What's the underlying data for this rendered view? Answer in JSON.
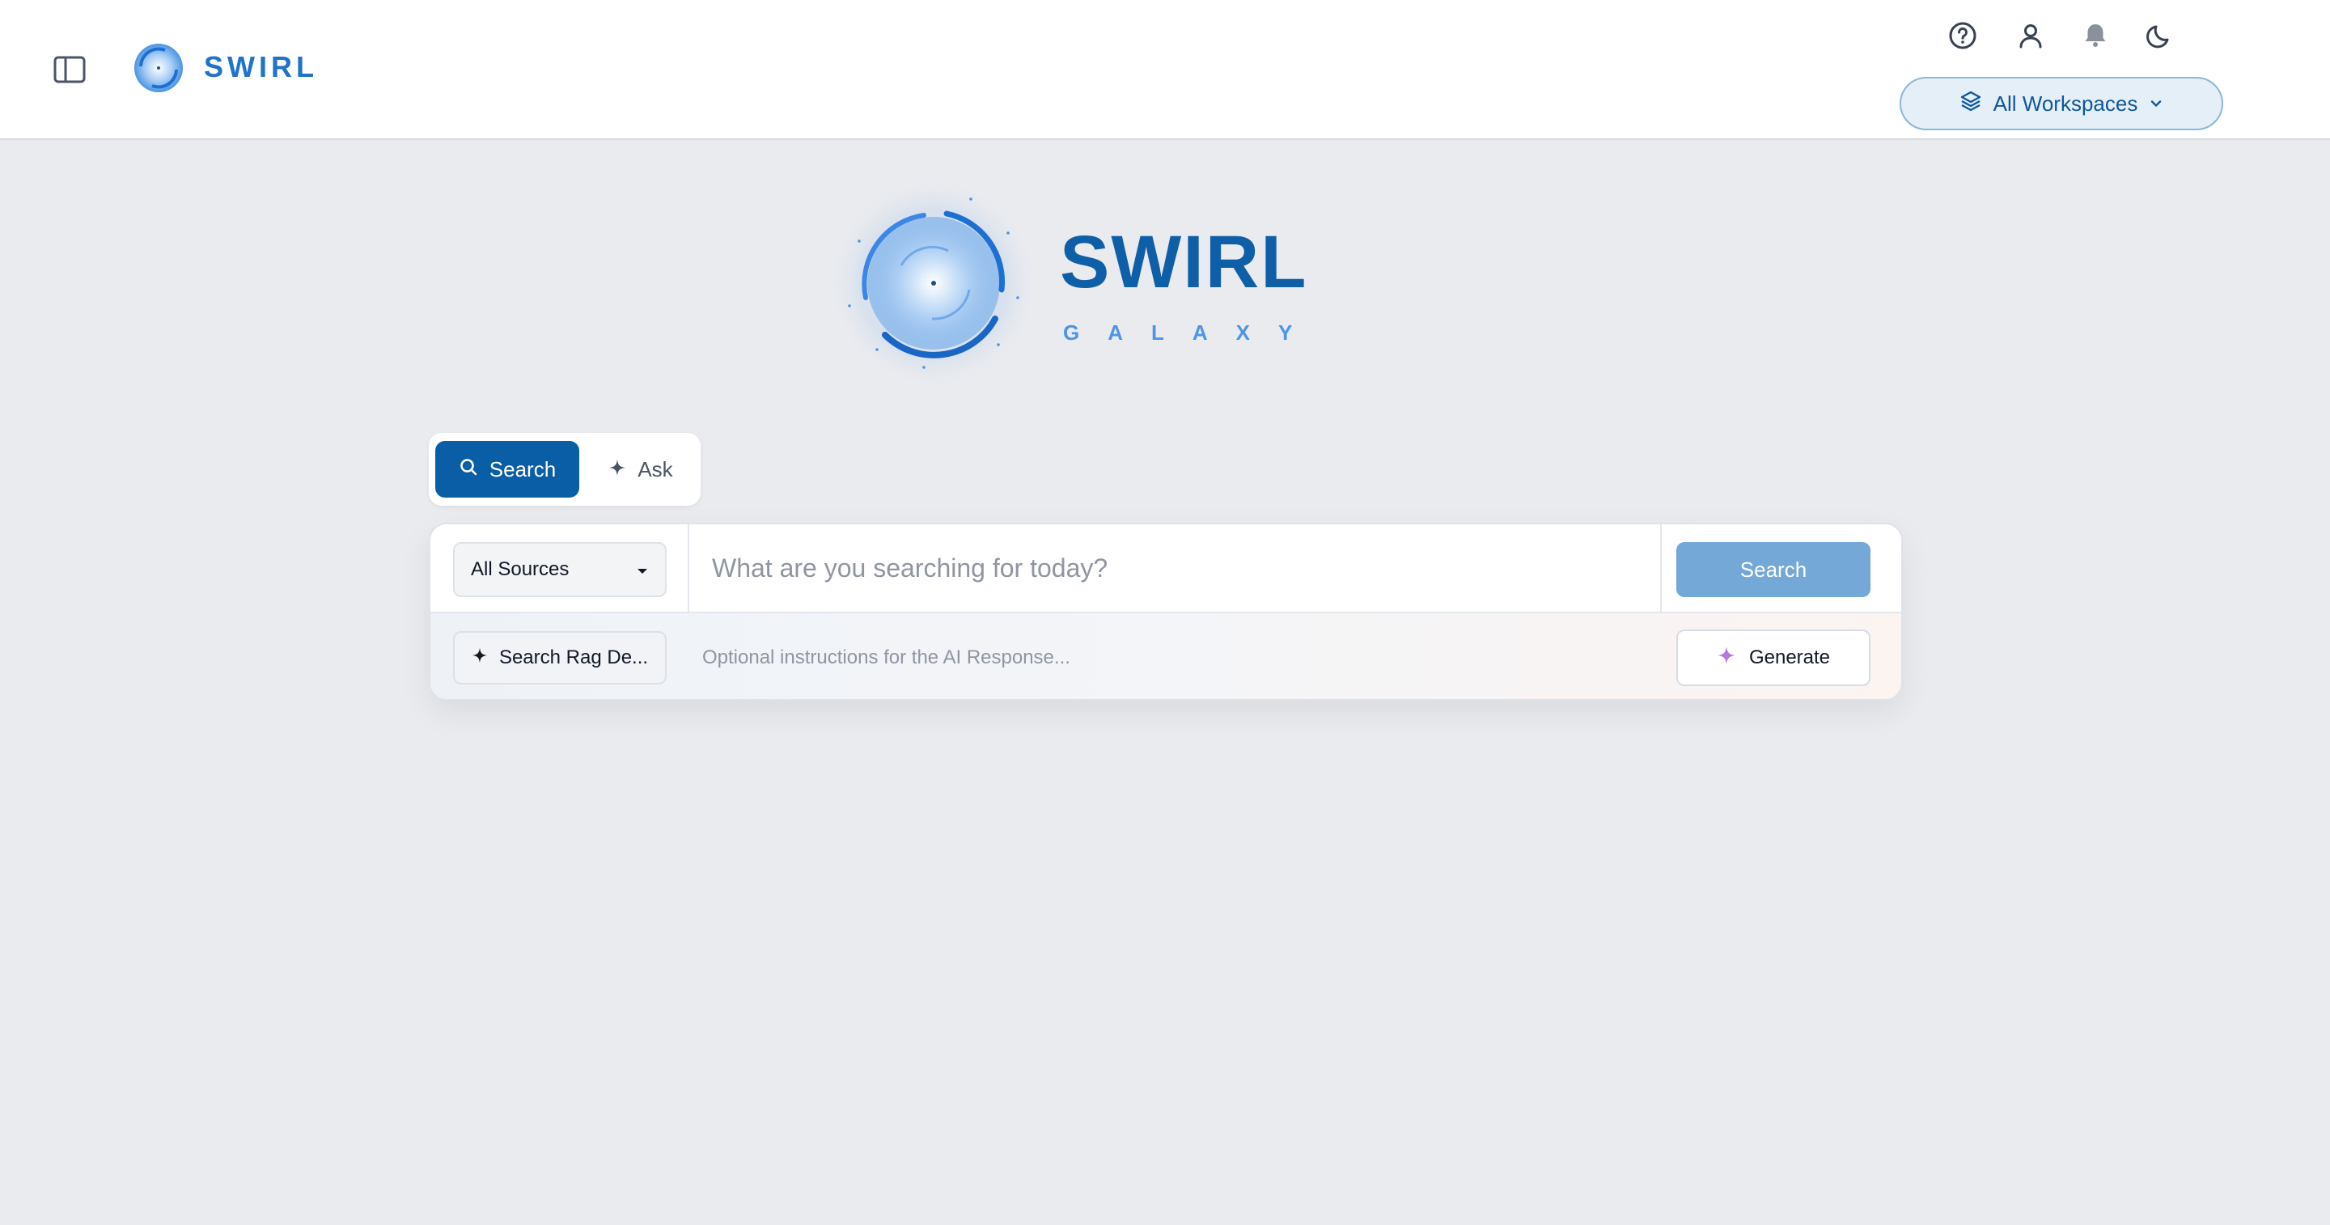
{
  "header": {
    "brand": "SWIRL",
    "workspace_selector": "All Workspaces",
    "icons": [
      "sidebar-toggle-icon",
      "help-icon",
      "user-icon",
      "bell-icon",
      "moon-icon"
    ]
  },
  "hero": {
    "title": "SWIRL",
    "subtitle": "GALAXY"
  },
  "mode_tabs": [
    {
      "label": "Search",
      "active": true
    },
    {
      "label": "Ask",
      "active": false
    }
  ],
  "search": {
    "source_selected": "All Sources",
    "placeholder": "What are you searching for today?",
    "button_label": "Search"
  },
  "ai": {
    "rag_button": "Search Rag De...",
    "placeholder": "Optional instructions for the AI Response...",
    "generate_label": "Generate"
  },
  "colors": {
    "primary": "#0a5ea6",
    "brand_text": "#1e74c9",
    "search_button": "#74a8d6",
    "background": "#e9ebef",
    "generate_sparkle": "#b476e0"
  }
}
